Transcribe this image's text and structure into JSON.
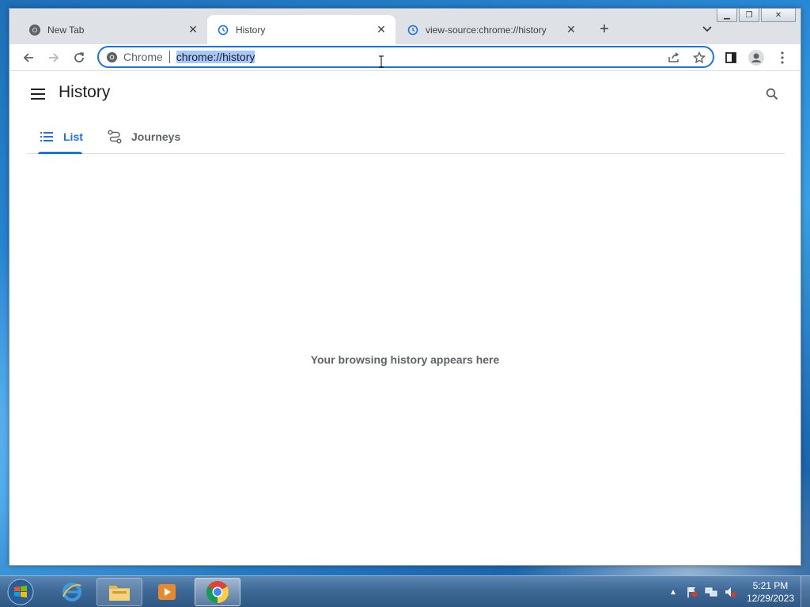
{
  "browser": {
    "tabs": [
      {
        "title": "New Tab",
        "icon": "chrome-icon",
        "active": false
      },
      {
        "title": "History",
        "icon": "history-icon",
        "active": true
      },
      {
        "title": "view-source:chrome://history",
        "icon": "history-icon",
        "active": false
      }
    ],
    "new_tab_label": "+",
    "omnibox": {
      "chip_label": "Chrome",
      "url": "chrome://history"
    }
  },
  "history_page": {
    "title": "History",
    "tabs": [
      {
        "label": "List",
        "selected": true
      },
      {
        "label": "Journeys",
        "selected": false
      }
    ],
    "empty_message": "Your browsing history appears here"
  },
  "taskbar": {
    "clock_time": "5:21 PM",
    "clock_date": "12/29/2023"
  },
  "colors": {
    "accent": "#1a73e8",
    "selection": "#a8c7fa",
    "tab_strip": "#dee1e6"
  }
}
